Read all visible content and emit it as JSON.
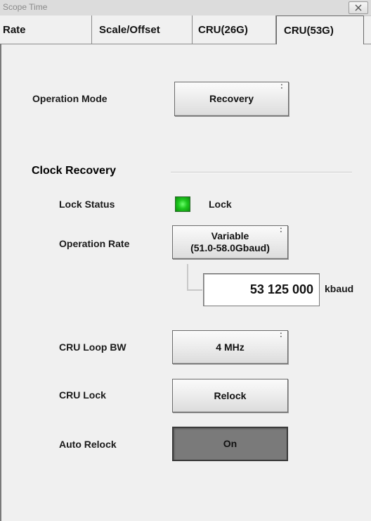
{
  "window": {
    "title": "Scope Time"
  },
  "tabs": [
    {
      "label": "Rate",
      "active": false
    },
    {
      "label": "Scale/Offset",
      "active": false
    },
    {
      "label": "CRU(26G)",
      "active": false
    },
    {
      "label": "CRU(53G)",
      "active": true
    }
  ],
  "operation_mode": {
    "label": "Operation Mode",
    "value": "Recovery"
  },
  "clock_recovery": {
    "section_label": "Clock Recovery",
    "lock_status": {
      "label": "Lock Status",
      "value": "Lock",
      "led_color": "#1ec81e"
    },
    "operation_rate": {
      "label": "Operation Rate",
      "value_line1": "Variable",
      "value_line2": "(51.0-58.0Gbaud)"
    },
    "rate_value": {
      "value": "53 125 000",
      "unit": "kbaud"
    },
    "cru_loop_bw": {
      "label": "CRU Loop BW",
      "value": "4 MHz"
    },
    "cru_lock": {
      "label": "CRU Lock",
      "button": "Relock"
    },
    "auto_relock": {
      "label": "Auto Relock",
      "value": "On"
    }
  },
  "icons": {
    "close": "close-icon",
    "menu": "menu-dots-icon"
  }
}
